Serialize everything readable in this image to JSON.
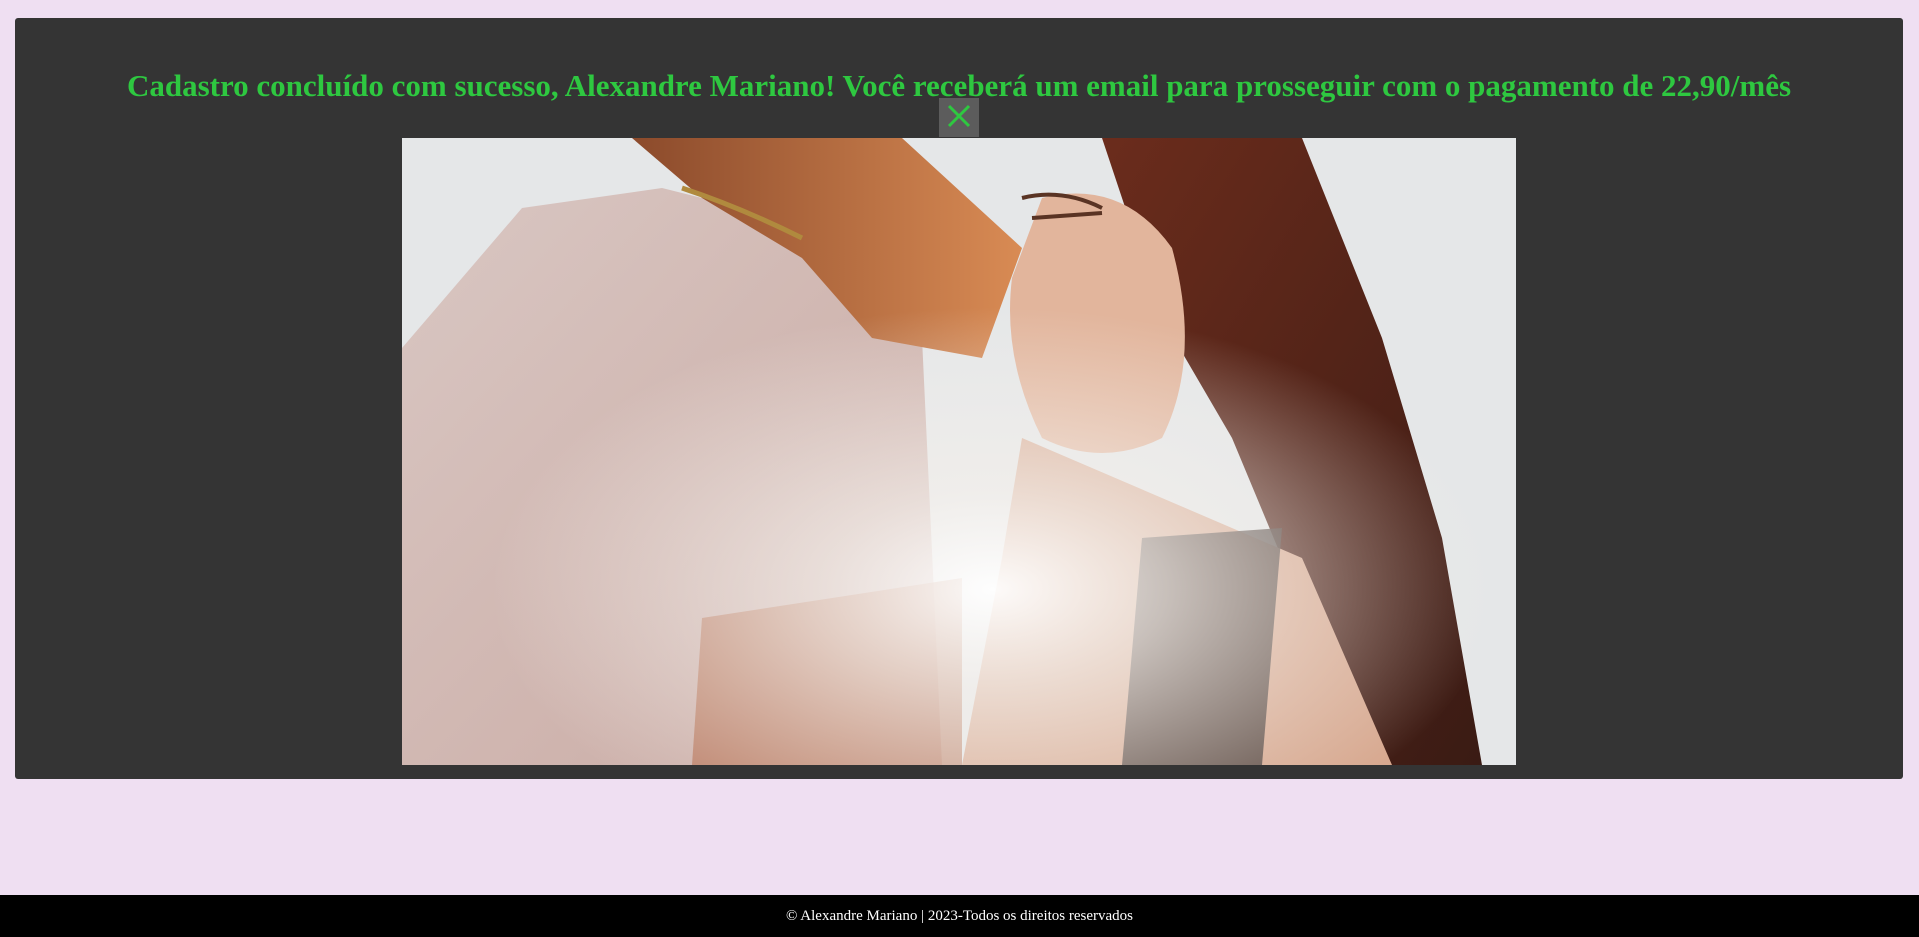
{
  "message": {
    "text": "Cadastro concluído com sucesso, Alexandre Mariano! Você receberá um email para prosseguir com o pagamento de 22,90/mês",
    "color": "#2ec840"
  },
  "close_button": {
    "icon": "close-icon",
    "color": "#2ec840"
  },
  "photo": {
    "alt": "Casal se abraçando"
  },
  "footer": {
    "text": "© Alexandre Mariano | 2023-Todos os direitos reservados"
  },
  "colors": {
    "page_background": "#efdff2",
    "panel_background": "#343434",
    "footer_background": "#000000"
  }
}
